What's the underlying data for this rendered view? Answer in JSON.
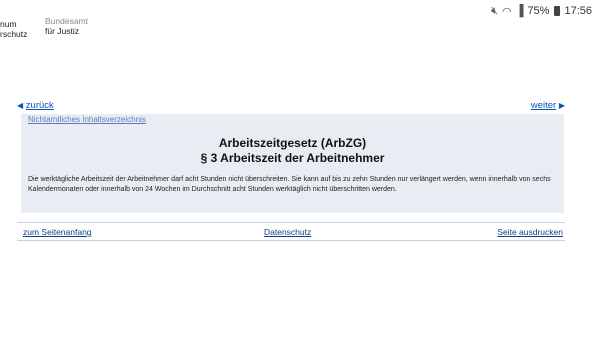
{
  "status_bar": {
    "icons": [
      "mute-icon",
      "wifi-icon",
      "signal-icon",
      "battery-icon"
    ],
    "battery": "75%",
    "time": "17:56"
  },
  "header": {
    "logo_left_line1": "num",
    "logo_left_line2": "rschutz",
    "logo_right_line1": "Bundesamt",
    "logo_right_line2": "für Justiz"
  },
  "nav": {
    "back_label": "zurück",
    "forward_label": "weiter",
    "back_icon": "arrow-left-icon",
    "forward_icon": "arrow-right-icon"
  },
  "document": {
    "toc_link": "Nichtamtliches Inhaltsverzeichnis",
    "law_title": "Arbeitszeitgesetz (ArbZG)",
    "section_title": "§ 3 Arbeitszeit der Arbeitnehmer",
    "body_text": "Die werktägliche Arbeitszeit der Arbeitnehmer darf acht Stunden nicht überschreiten. Sie kann auf bis zu zehn Stunden nur verlängert werden, wenn innerhalb von sechs Kalendermonaten oder innerhalb von 24 Wochen im Durchschnitt acht Stunden werktäglich nicht überschritten werden."
  },
  "footer": {
    "top_link": "zum Seitenanfang",
    "privacy_link": "Datenschutz",
    "print_link": "Seite ausdrucken"
  },
  "colors": {
    "link": "#0b54b5",
    "panel_background": "#e8edf4"
  }
}
